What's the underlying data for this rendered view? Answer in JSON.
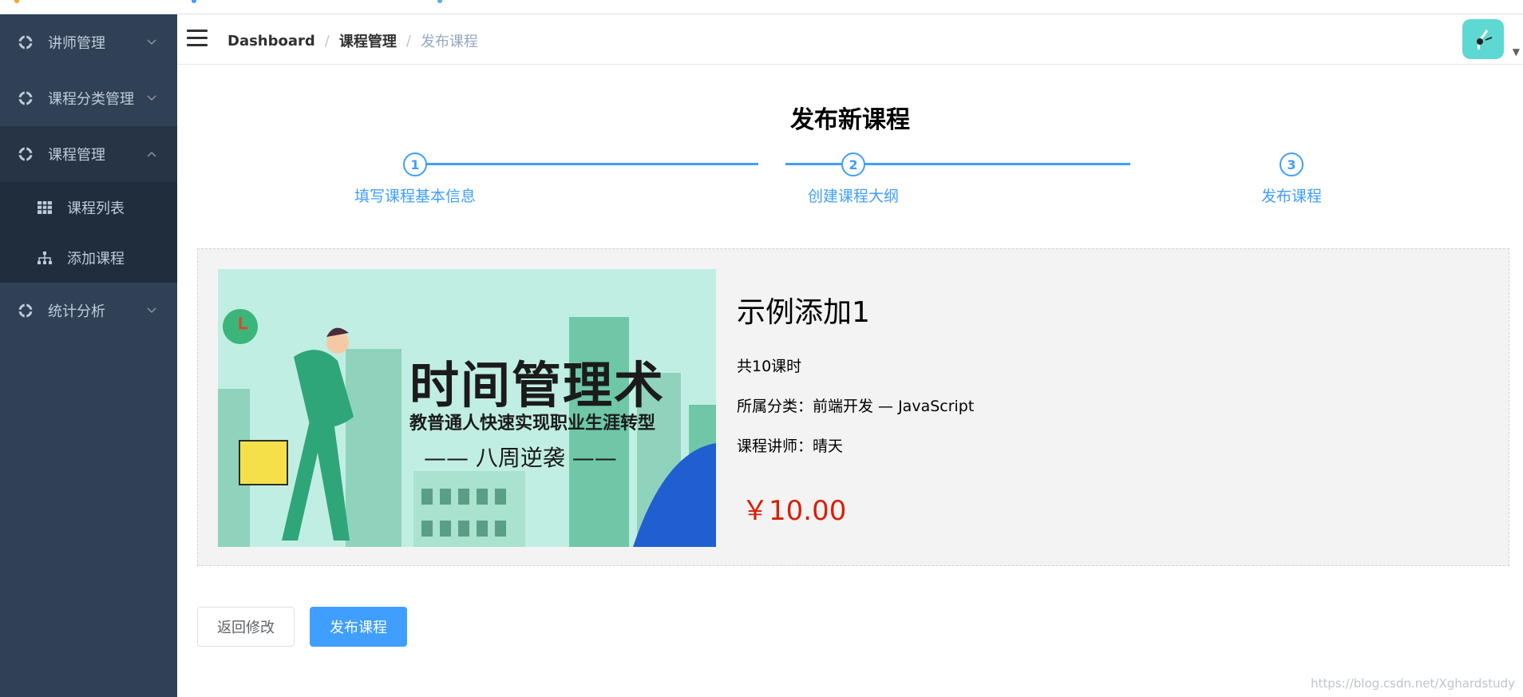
{
  "sidebar": {
    "items": [
      {
        "label": "讲师管理",
        "icon": "gear-icon",
        "expanded": false
      },
      {
        "label": "课程分类管理",
        "icon": "gear-icon",
        "expanded": false
      },
      {
        "label": "课程管理",
        "icon": "gear-icon",
        "expanded": true,
        "children": [
          {
            "label": "课程列表",
            "icon": "table-icon"
          },
          {
            "label": "添加课程",
            "icon": "tree-icon"
          }
        ]
      },
      {
        "label": "统计分析",
        "icon": "gear-icon",
        "expanded": false
      }
    ]
  },
  "navbar": {
    "breadcrumb": [
      "Dashboard",
      "课程管理",
      "发布课程"
    ],
    "avatar_icon": "avatar-icon"
  },
  "page": {
    "title": "发布新课程",
    "steps": [
      {
        "number": "1",
        "title": "填写课程基本信息"
      },
      {
        "number": "2",
        "title": "创建课程大纲"
      },
      {
        "number": "3",
        "title": "发布课程"
      }
    ]
  },
  "course": {
    "cover": {
      "title": "时间管理术",
      "subtitle": "教普通人快速实现职业生涯转型",
      "tagline": "—— 八周逆袭 ——"
    },
    "name": "示例添加1",
    "lesson_count": "共10课时",
    "category": "所属分类：前端开发 — JavaScript",
    "teacher": "课程讲师：晴天",
    "price": "￥10.00"
  },
  "actions": {
    "back_label": "返回修改",
    "publish_label": "发布课程"
  },
  "watermark": "https://blog.csdn.net/Xghardstudy",
  "colors": {
    "sidebar_bg": "#304156",
    "primary": "#409eff",
    "price": "#d81e06",
    "avatar_bg": "#5dd8d3"
  }
}
